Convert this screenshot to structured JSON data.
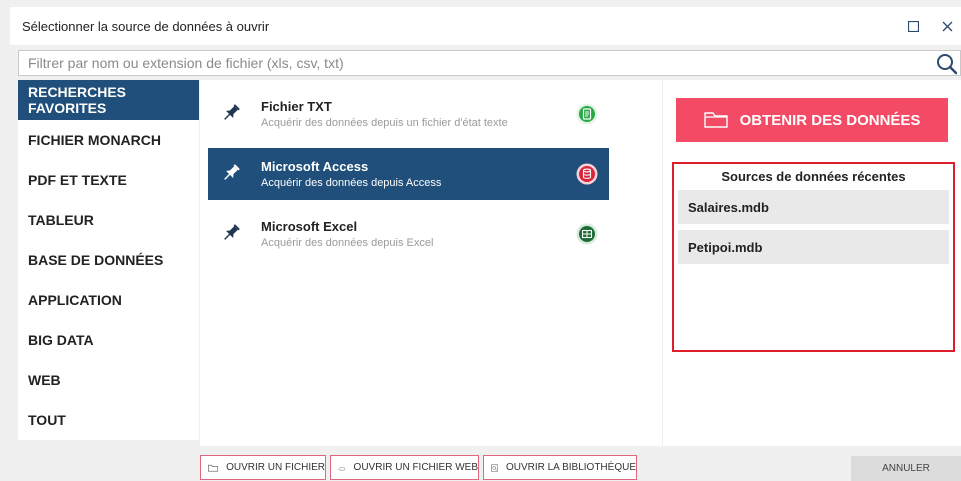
{
  "window": {
    "title": "Sélectionner la source de données à ouvrir"
  },
  "filter": {
    "placeholder": "Filtrer par nom ou extension de fichier (xls, csv, txt)",
    "value": ""
  },
  "categories": [
    {
      "label": "RECHERCHES FAVORITES",
      "active": true
    },
    {
      "label": "FICHIER MONARCH"
    },
    {
      "label": "PDF ET TEXTE"
    },
    {
      "label": "TABLEUR"
    },
    {
      "label": "BASE DE DONNÉES"
    },
    {
      "label": "APPLICATION"
    },
    {
      "label": "BIG DATA"
    },
    {
      "label": "WEB"
    },
    {
      "label": "TOUT"
    }
  ],
  "sources": [
    {
      "name": "Fichier TXT",
      "description": "Acquérir des données depuis un fichier d'état texte",
      "icon": "text-file-icon",
      "color": "#27a845"
    },
    {
      "name": "Microsoft Access",
      "description": "Acquérir des données depuis Access",
      "icon": "database-icon",
      "color": "#d7263d",
      "selected": true
    },
    {
      "name": "Microsoft Excel",
      "description": "Acquérir des données depuis Excel",
      "icon": "spreadsheet-icon",
      "color": "#1e6b35"
    }
  ],
  "actions": {
    "get_data": "OBTENIR DES DONNÉES",
    "open_file": "OUVRIR UN FICHIER",
    "open_web_file": "OUVRIR UN FICHIER WEB",
    "open_library": "OUVRIR LA BIBLIOTHÈQUE",
    "cancel": "ANNULER"
  },
  "recent": {
    "title": "Sources de données récentes",
    "items": [
      "Salaires.mdb",
      "Petipoi.mdb"
    ]
  },
  "colors": {
    "accent": "#f34a66",
    "selected": "#1f4f7a",
    "highlight_border": "#dd1f2c"
  }
}
